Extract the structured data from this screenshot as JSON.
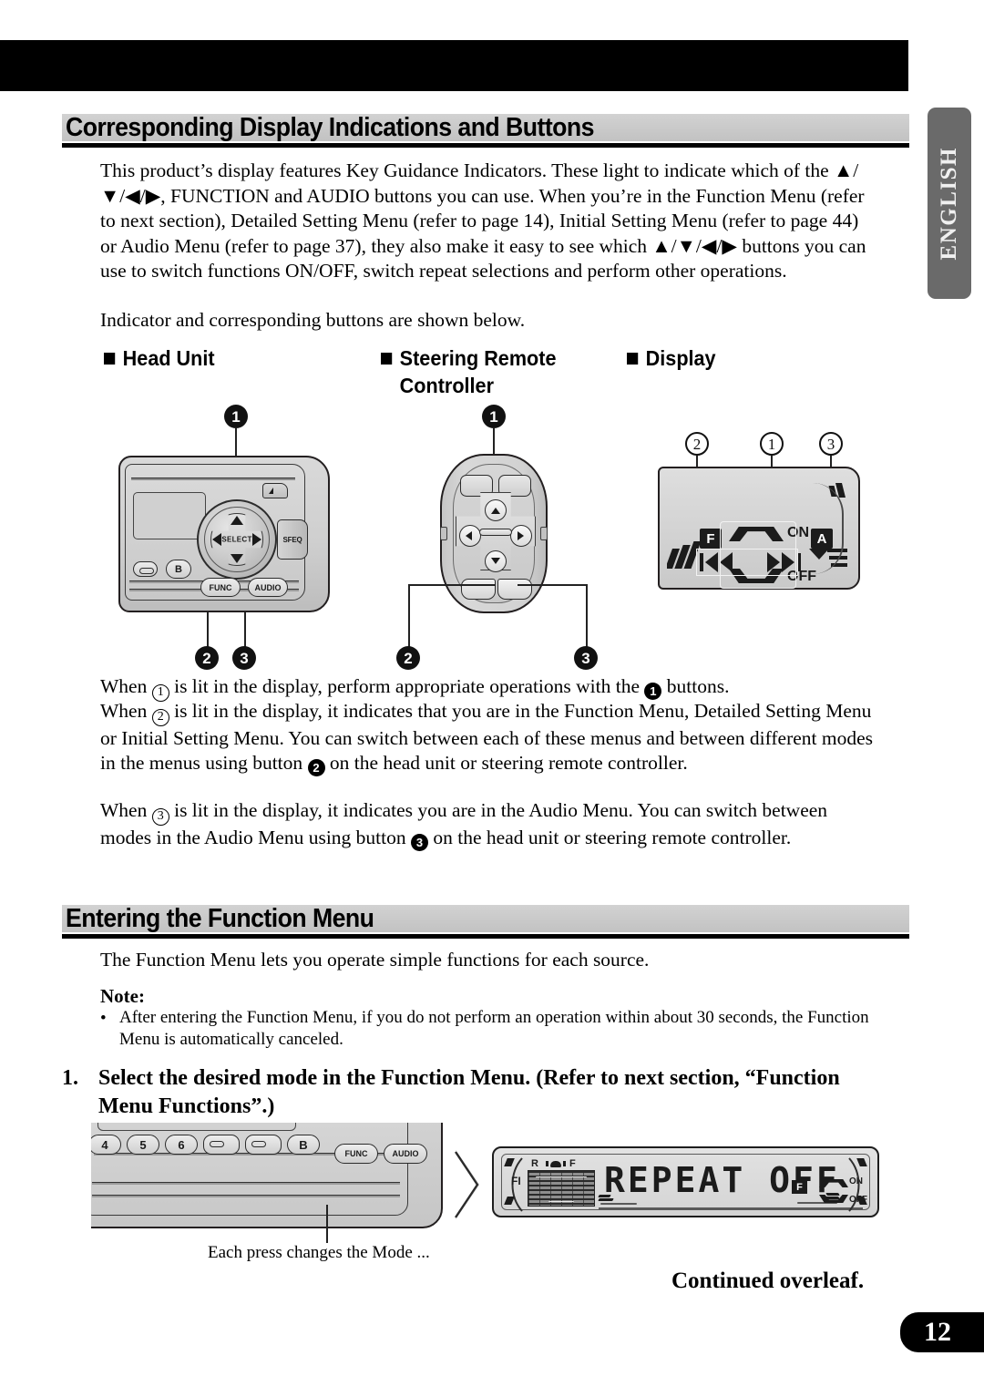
{
  "lang_tab": "ENGLISH",
  "sections": {
    "first": {
      "heading": "Corresponding Display Indications and Buttons",
      "intro": "This product’s display features Key Guidance Indicators. These light to indicate which of the ▲/▼/◀/▶, FUNCTION and AUDIO buttons you can use. When you’re in the Function Menu (refer to next section), Detailed Setting Menu (refer to page 14), Initial Setting Menu (refer to page 44) or Audio Menu (refer to page 37), they also make it easy to see which ▲/▼/◀/▶ buttons you can use to switch functions ON/OFF, switch repeat selections and perform other operations.",
      "intro2": "Indicator and corresponding buttons are shown below."
    },
    "second": {
      "heading": "Entering the Function Menu",
      "intro": "The Function Menu lets you operate simple functions for each source.",
      "note_label": "Note:",
      "note_bullet": "•",
      "note_text": "After entering the Function Menu, if you do not perform an operation within about 30 seconds, the Function Menu is automatically canceled.",
      "step_number": "1.",
      "step_text": "Select the desired mode in the Function Menu. (Refer to next section, “Function Menu Functions”.)",
      "caption": "Each press changes the Mode ..."
    }
  },
  "diagram_headers": {
    "head_unit": "Head Unit",
    "steering_remote": "Steering Remote Controller",
    "steering_remote_l1": "Steering Remote",
    "steering_remote_l2": "Controller",
    "display": "Display"
  },
  "head_unit": {
    "select_label": "SELECT",
    "sfeq_label": "SFEQ",
    "func_label": "FUNC",
    "audio_label": "AUDIO",
    "b_label": "B",
    "callout_1": "1",
    "callout_2": "2",
    "callout_3": "3"
  },
  "steering_remote": {
    "callout_1": "1",
    "callout_2": "2",
    "callout_3": "3"
  },
  "display_panel": {
    "callout_1": "1",
    "callout_2": "2",
    "callout_3": "3",
    "indicator_f": "F",
    "indicator_a": "A",
    "label_on": "ON",
    "label_off": "OFF"
  },
  "explanations": {
    "p1_a": "When ",
    "p1_n1": "1",
    "p1_b": " is lit in the display, perform appropriate operations with the ",
    "p1_n2": "1",
    "p1_c": " buttons.",
    "p2_a": "When ",
    "p2_n1": "2",
    "p2_b": " is lit in the display, it indicates that you are in the Function Menu, Detailed Setting Menu or Initial Setting Menu. You can switch between each of these menus and between different modes in the menus using button ",
    "p2_n2": "2",
    "p2_c": " on the head unit or steering remote controller.",
    "p3_a": "When ",
    "p3_n1": "3",
    "p3_b": " is lit in the display, it indicates you are in the Audio Menu. You can switch between modes in the Audio Menu using button ",
    "p3_n2": "3",
    "p3_c": " on the head unit or steering remote controller."
  },
  "bottom_head_unit": {
    "preset_4": "4",
    "preset_5": "5",
    "preset_6": "6",
    "b_label": "B",
    "func_label": "FUNC",
    "audio_label": "AUDIO"
  },
  "lcd_screen": {
    "main_text": "REPEAT OFF",
    "indicator_fl": "FI",
    "indicator_r": "R",
    "indicator_f": "F",
    "indicator_f_box": "F",
    "label_on": "ON",
    "label_off": "OFF"
  },
  "footer": {
    "continued": "Continued overleaf.",
    "page_number": "12"
  },
  "colors": {
    "bar_black": "#000000",
    "band_gray": "#cccccc",
    "lang_tab_gray": "#6a6a6a",
    "panel_gray": "#d2d2d2"
  }
}
